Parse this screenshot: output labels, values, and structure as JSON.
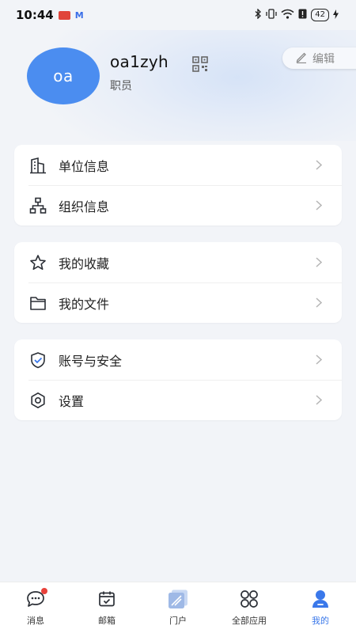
{
  "status_bar": {
    "time": "10:44",
    "battery": "42"
  },
  "profile": {
    "avatar_text": "oa",
    "username": "oa1zyh",
    "role": "职员",
    "edit_label": "编辑"
  },
  "menu_groups": [
    {
      "items": [
        {
          "label": "单位信息",
          "icon": "building-icon"
        },
        {
          "label": "组织信息",
          "icon": "org-chart-icon"
        }
      ]
    },
    {
      "items": [
        {
          "label": "我的收藏",
          "icon": "star-icon"
        },
        {
          "label": "我的文件",
          "icon": "folder-icon"
        }
      ]
    },
    {
      "items": [
        {
          "label": "账号与安全",
          "icon": "shield-check-icon"
        },
        {
          "label": "设置",
          "icon": "gear-icon"
        }
      ]
    }
  ],
  "tabbar": {
    "tabs": [
      {
        "label": "消息",
        "icon": "chat-bubble-icon",
        "badge": true
      },
      {
        "label": "邮箱",
        "icon": "calendar-check-icon"
      },
      {
        "label": "门户",
        "icon": "portal-icon"
      },
      {
        "label": "全部应用",
        "icon": "apps-grid-icon"
      },
      {
        "label": "我的",
        "icon": "user-icon",
        "active": true
      }
    ]
  },
  "colors": {
    "accent": "#3a78ea",
    "avatar_bg": "#4b8df0",
    "badge": "#e8413a"
  }
}
